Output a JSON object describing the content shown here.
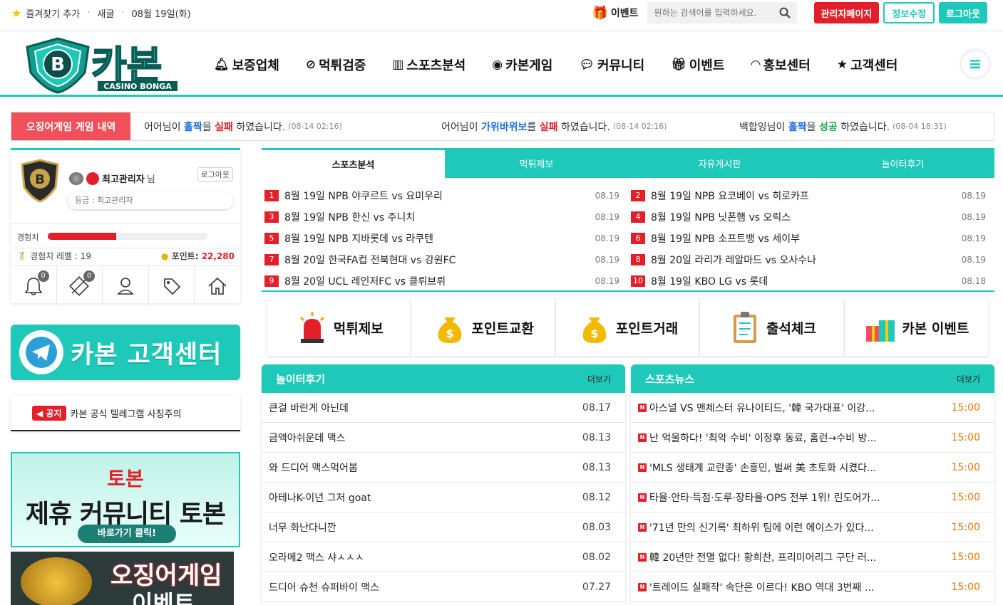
{
  "topbar": {
    "bookmark": "즐겨찾기 추가",
    "refresh": "새글",
    "date": "08월 19일(화)",
    "event": "이벤트",
    "search_placeholder": "원하는 검색어를 입력하세요.",
    "admin": "관리자페이지",
    "edit": "정보수정",
    "logout": "로그아웃"
  },
  "logo": {
    "main": "카본",
    "sub": "CASINO BONGA"
  },
  "nav": [
    {
      "label": "보증업체",
      "icon": "bell-icon"
    },
    {
      "label": "먹튀검증",
      "icon": "ban-icon"
    },
    {
      "label": "스포츠분석",
      "icon": "chart-icon"
    },
    {
      "label": "카본게임",
      "icon": "gamepad-icon"
    },
    {
      "label": "커뮤니티",
      "icon": "chat-icon"
    },
    {
      "label": "이벤트",
      "icon": "gift-icon"
    },
    {
      "label": "홍보센터",
      "icon": "rss-icon"
    },
    {
      "label": "고객센터",
      "icon": "star-icon"
    }
  ],
  "ticker": {
    "label": "오징어게임 게임 내역",
    "items": [
      {
        "user": "어어",
        "game": "홀짝",
        "result": "실패",
        "tail": "하였습니다.",
        "date": "(08-14 02:16)",
        "suffix": "님이",
        "josa": "을"
      },
      {
        "user": "어어",
        "game": "가위바위보",
        "result": "실패",
        "tail": "하였습니다.",
        "date": "(08-14 02:16)",
        "suffix": "님이",
        "josa": "를"
      },
      {
        "user": "백합잉",
        "game": "홀짝",
        "result": "성공",
        "tail": "하였습니다.",
        "date": "(08-04 18:31)",
        "suffix": "님이",
        "josa": "을"
      }
    ]
  },
  "profile": {
    "name": "최고관리자",
    "nim": "님",
    "logout": "로그아웃",
    "grade": "등급 : 최고관리자",
    "exp_label": "경험치",
    "exp_fraction": 0.43,
    "level_label": "경험치 레벨 : 19",
    "points_label": "포인트:",
    "points": "22,280",
    "notif_count": "0",
    "memo_count": "0"
  },
  "telegram": {
    "label": "카본 고객센터"
  },
  "notice": {
    "tag": "공지",
    "text": "카본 공식 텔레그램 사칭주의"
  },
  "banner1": {
    "top": "토본",
    "mid": "제휴 커뮤니티 토본",
    "btn": "바로가기 클릭!"
  },
  "banner2": {
    "line1": "오징어게임",
    "line2": "이벤트"
  },
  "tabs": [
    "스포츠분석",
    "먹튀제보",
    "자유게시판",
    "놀이터후기"
  ],
  "posts": [
    {
      "n": "1",
      "title": "8월 19일 NPB 야쿠르트 vs 요미우리",
      "date": "08.19"
    },
    {
      "n": "2",
      "title": "8월 19일 NPB 요코베이 vs 히로카프",
      "date": "08.19"
    },
    {
      "n": "3",
      "title": "8월 19일 NPB 한신 vs 주니치",
      "date": "08.19"
    },
    {
      "n": "4",
      "title": "8월 19일 NPB 닛폰햄 vs 오릭스",
      "date": "08.19"
    },
    {
      "n": "5",
      "title": "8월 19일 NPB 지바롯데 vs 라쿠텐",
      "date": "08.19"
    },
    {
      "n": "6",
      "title": "8월 19일 NPB 소프트뱅 vs 세이부",
      "date": "08.19"
    },
    {
      "n": "7",
      "title": "8월 20일 한국FA컵 전북현대 vs 강원FC",
      "date": "08.19"
    },
    {
      "n": "8",
      "title": "8월 20일 라리가 레알마드 vs 오사수나",
      "date": "08.19"
    },
    {
      "n": "9",
      "title": "8월 20일 UCL 레인저FC vs 클뤼브뤼",
      "date": "08.19"
    },
    {
      "n": "10",
      "title": "8월 19일 KBO LG vs 롯데",
      "date": "08.18"
    }
  ],
  "quick": [
    {
      "label": "먹튀제보",
      "icon": "siren-icon"
    },
    {
      "label": "포인트교환",
      "icon": "money-bag-icon"
    },
    {
      "label": "포인트거래",
      "icon": "money-bag-icon"
    },
    {
      "label": "출석체크",
      "icon": "clipboard-icon"
    },
    {
      "label": "카본 이벤트",
      "icon": "gift-box-icon"
    }
  ],
  "reviews": {
    "title": "놀이터후기",
    "more": "더보기",
    "items": [
      {
        "title": "큰걸 바란게 아닌데",
        "date": "08.17"
      },
      {
        "title": "금액아쉬운데 맥스",
        "date": "08.13"
      },
      {
        "title": "와 드디어 맥스먹어봄",
        "date": "08.13"
      },
      {
        "title": "아테나K-이년 그저 goat",
        "date": "08.12"
      },
      {
        "title": "너무 화난다니깐",
        "date": "08.03"
      },
      {
        "title": "오라메2 맥스 샤ㅅㅅㅅ",
        "date": "08.02"
      },
      {
        "title": "드디어 슈천 슈퍼바이 맥스",
        "date": "07.27"
      }
    ]
  },
  "news": {
    "title": "스포츠뉴스",
    "more": "더보기",
    "new_tag": "N",
    "items": [
      {
        "title": "아스널 VS 맨체스터 유나이티드, '韓 국가대표' 이강...",
        "date": "15:00"
      },
      {
        "title": "난 억울하다! '최악 수비' 이정후 동료, 홈런→수비 방...",
        "date": "15:00"
      },
      {
        "title": "'MLS 생태계 교란종' 손흥민, 벌써 美 초토화 시켰다...",
        "date": "15:00"
      },
      {
        "title": "타율·안타·득점·도루·장타율·OPS 전부 1위! 린도어가...",
        "date": "15:00"
      },
      {
        "title": "'71년 만의 신기록' 최하위 팀에 이런 에이스가 있다...",
        "date": "15:00"
      },
      {
        "title": "韓 20년만 전멸 없다! 황희찬, 프리미어리그 구단 러...",
        "date": "15:00"
      },
      {
        "title": "'트레이드 실패작' 속단은 이르다! KBO 역대 3번째 ...",
        "date": "15:00"
      }
    ]
  }
}
